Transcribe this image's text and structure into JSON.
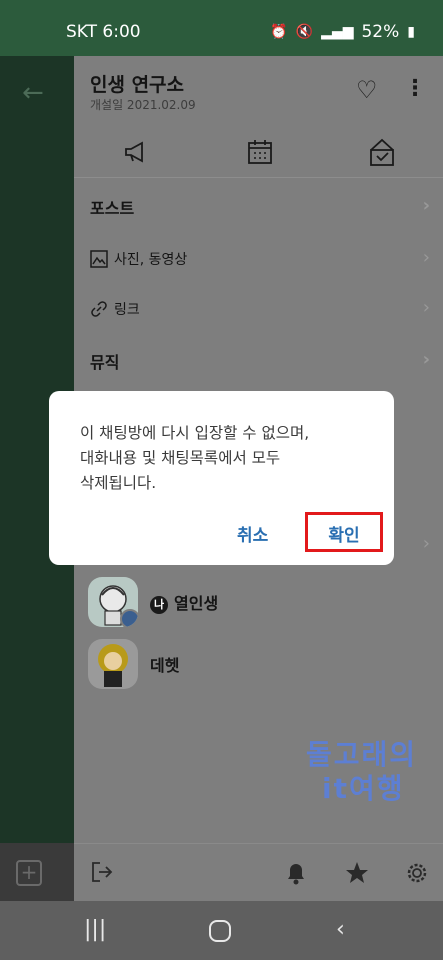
{
  "status_bar": {
    "left": "SKT 6:00",
    "battery": "52%"
  },
  "drawer": {
    "title": "인생 연구소",
    "date": "개설일 2021.02.09",
    "menu": {
      "posts": "포스트",
      "photos": "사진, 동영상",
      "links": "링크",
      "music": "뮤직"
    },
    "members": [
      {
        "name": "열인생",
        "badge": "나"
      },
      {
        "name": "데헷"
      }
    ]
  },
  "dialog": {
    "message": "이 채팅방에 다시 입장할 수 없으며,\n대화내용 및 채팅목록에서 모두\n삭제됩니다.",
    "cancel": "취소",
    "confirm": "확인"
  },
  "watermark": {
    "line1": "돌고래의",
    "line2": "it여행"
  },
  "icons": [
    "back-arrow-icon",
    "heart-icon",
    "more-icon",
    "megaphone-icon",
    "calendar-icon",
    "gift-box-icon",
    "photo-icon",
    "link-icon",
    "chevron-right-icon",
    "exit-icon",
    "bell-icon",
    "star-icon",
    "gear-icon",
    "plus-icon",
    "recent-apps-icon",
    "home-icon",
    "nav-back-icon"
  ],
  "colors": {
    "status_bar": "#2c5b3c",
    "confirm_highlight": "#e2191b",
    "button_text": "#2a6fb2"
  }
}
